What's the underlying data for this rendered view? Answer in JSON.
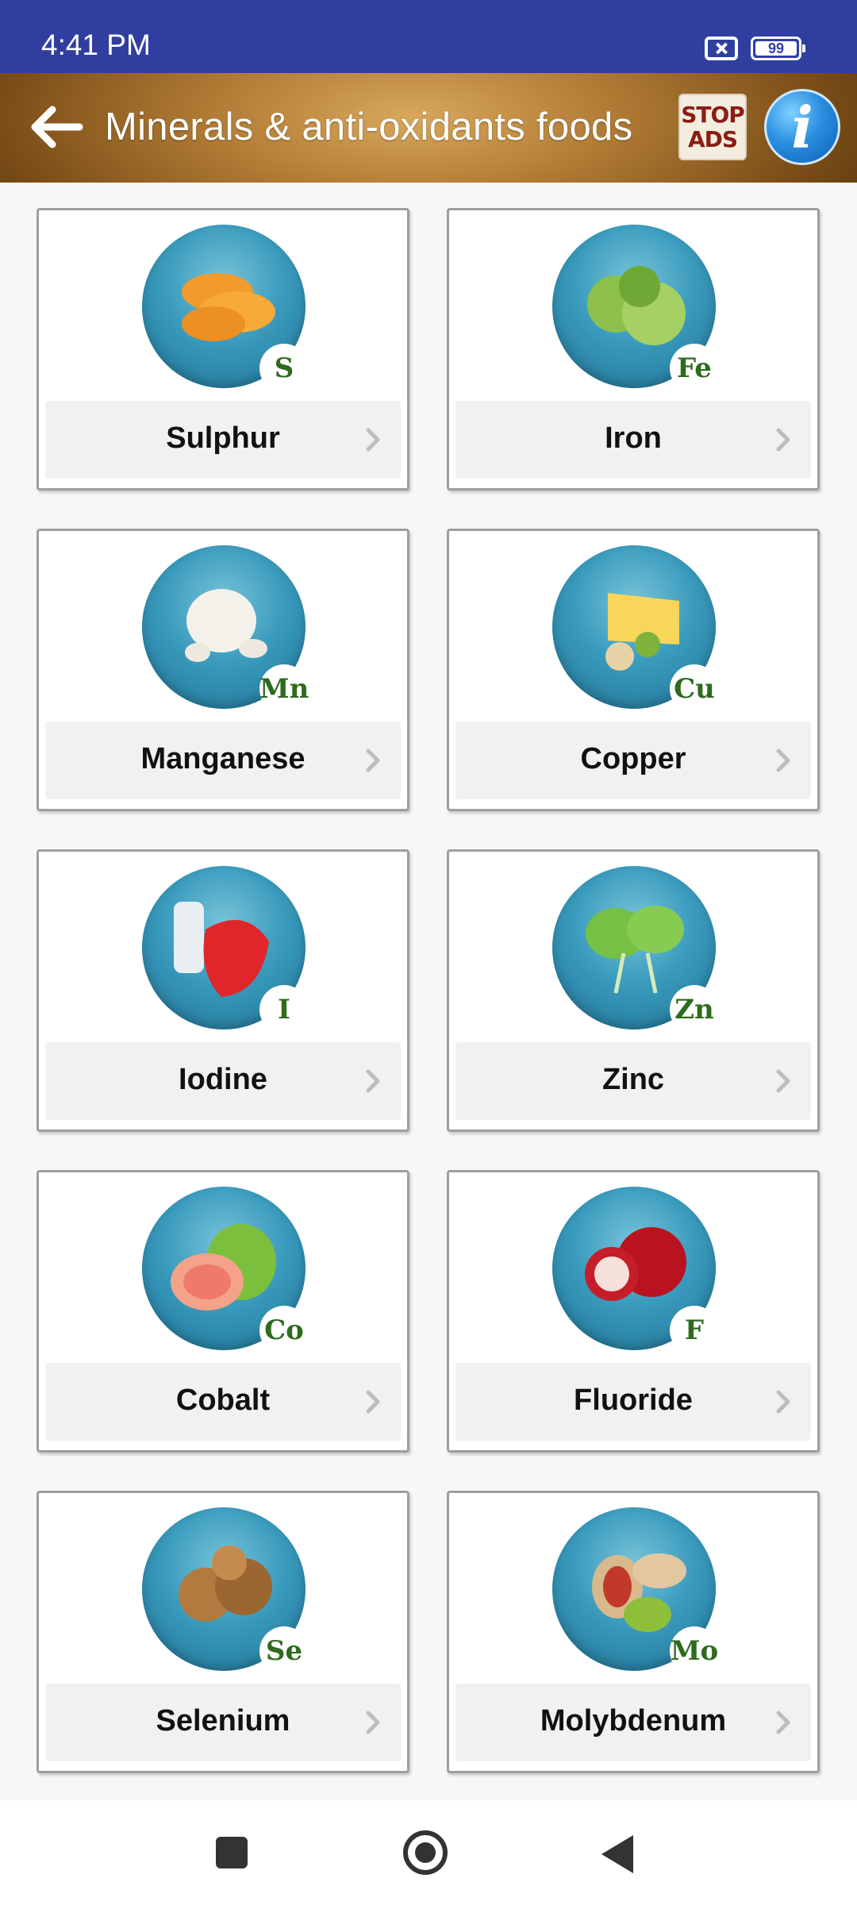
{
  "status_bar": {
    "time": "4:41 PM",
    "battery": "99",
    "icons": [
      "no-sim-icon",
      "battery-icon"
    ]
  },
  "app_bar": {
    "back_icon": "arrow-left-icon",
    "title": "Minerals & anti-oxidants foods",
    "stop_ads_line1": "STOP",
    "stop_ads_line2": "ADS",
    "info_label": "i"
  },
  "minerals": [
    {
      "label": "Sulphur",
      "symbol": "S",
      "image": "dried-apricots"
    },
    {
      "label": "Iron",
      "symbol": "Fe",
      "image": "brussels-sprouts"
    },
    {
      "label": "Manganese",
      "symbol": "Mn",
      "image": "garlic"
    },
    {
      "label": "Copper",
      "symbol": "Cu",
      "image": "cheese-cashews"
    },
    {
      "label": "Iodine",
      "symbol": "I",
      "image": "salt-strawberry"
    },
    {
      "label": "Zinc",
      "symbol": "Zn",
      "image": "spinach"
    },
    {
      "label": "Cobalt",
      "symbol": "Co",
      "image": "guava"
    },
    {
      "label": "Fluoride",
      "symbol": "F",
      "image": "pomegranate"
    },
    {
      "label": "Selenium",
      "symbol": "Se",
      "image": "walnuts"
    },
    {
      "label": "Molybdenum",
      "symbol": "Mo",
      "image": "pistachios"
    }
  ],
  "nav_bar": {
    "icons": [
      "recents-square-icon",
      "home-circle-icon",
      "back-triangle-icon"
    ]
  },
  "colors": {
    "status_bar": "#303f9f",
    "app_bar": "#8a5a20",
    "card_border": "#9e9e9e",
    "label_bar": "#f1f1f1",
    "symbol_text": "#2e6b1e",
    "thumb": "#3a9bbd"
  }
}
